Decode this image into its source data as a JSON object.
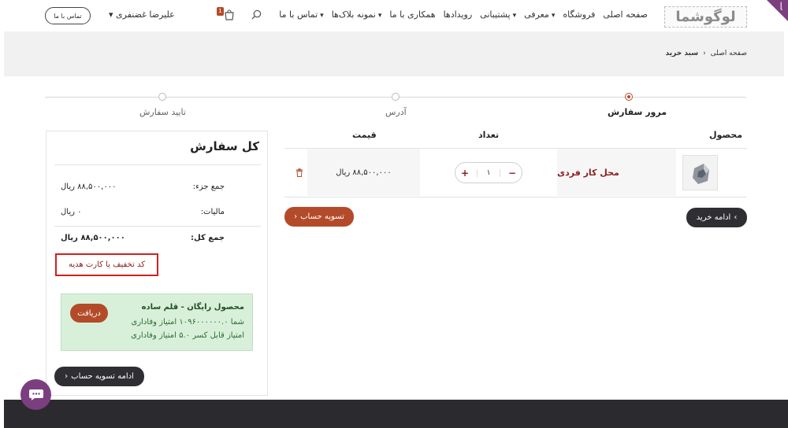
{
  "header": {
    "logo_text": "لوگوشما",
    "nav": [
      {
        "label": "صفحه اصلی",
        "caret": false
      },
      {
        "label": "فروشگاه",
        "caret": false
      },
      {
        "label": "معرفی",
        "caret": true
      },
      {
        "label": "پشتیبانی",
        "caret": true
      },
      {
        "label": "رویدادها",
        "caret": false
      },
      {
        "label": "همکاری با ما",
        "caret": false
      },
      {
        "label": "نمونه بلاک‌ها",
        "caret": true
      },
      {
        "label": "تماس با ما",
        "caret": true
      }
    ],
    "cart_count": "1",
    "user_name": "علیرضا غضنفری",
    "contact_button": "تماس با ما"
  },
  "breadcrumb": {
    "home": "صفحه اصلی",
    "current": "سبد خرید"
  },
  "steps": [
    {
      "label": "مرور سفارش",
      "active": true
    },
    {
      "label": "آدرس",
      "active": false
    },
    {
      "label": "تایید سفارش",
      "active": false
    }
  ],
  "cart_table": {
    "headers": {
      "product": "محصول",
      "quantity": "تعداد",
      "price": "قیمت"
    },
    "row": {
      "product_name": "محل کار فردی",
      "quantity": "۱",
      "price": "۸۸,۵۰۰,۰۰۰ ریال"
    }
  },
  "buttons": {
    "checkout": "تسویه حساب",
    "continue_shopping": "ادامه خرید",
    "continue_checkout": "ادامه تسویه حساب"
  },
  "summary": {
    "title": "کل سفارش",
    "subtotal_label": "جمع جزء:",
    "subtotal_value": "۸۸,۵۰۰,۰۰۰ ریال",
    "tax_label": "مالیات:",
    "tax_value": "۰ ریال",
    "total_label": "جمع کل:",
    "total_value": "۸۸,۵۰۰,۰۰۰ ریال",
    "coupon_link": "کد تخفیف یا کارت هدیه"
  },
  "reward": {
    "title": "محصول رایگان - قلم ساده",
    "line1": "شما ۱۰۹۶۰۰۰۰۰۰.۰ امتیاز وفاداری",
    "line2": "امتیاز قابل کسر ۵.۰ امتیاز وفاداری",
    "button": "دریافت"
  },
  "colors": {
    "accent": "#b34b2a",
    "brand_purple": "#7b3f7f",
    "dark": "#2f2f33",
    "reward_bg": "#d8f0d9"
  }
}
